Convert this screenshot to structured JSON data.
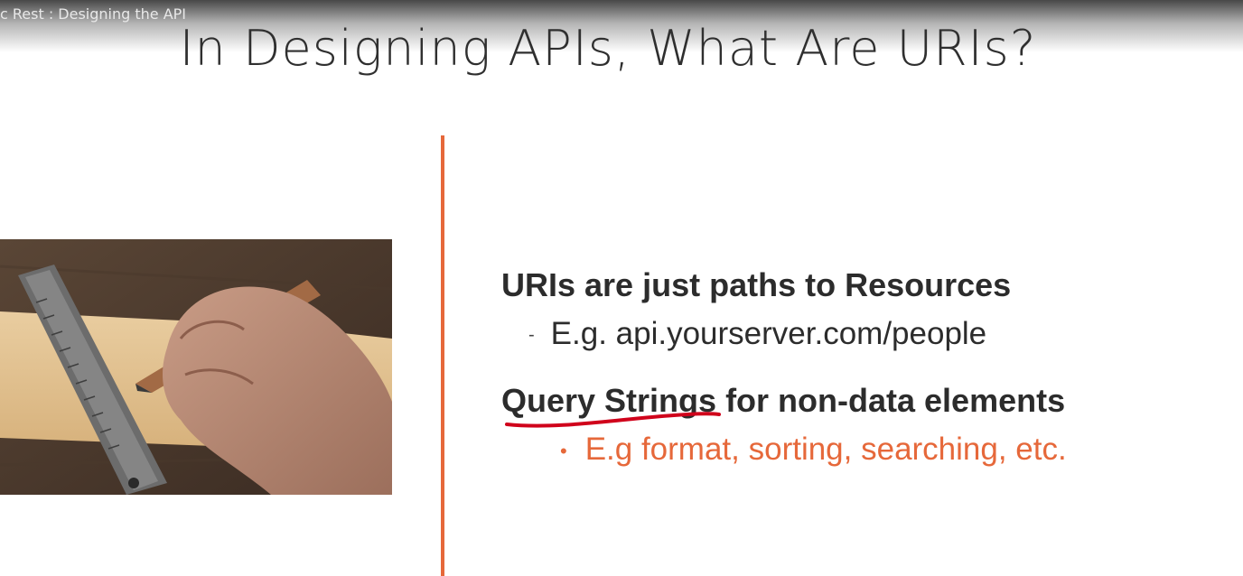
{
  "video": {
    "title": "c Rest : Designing the API"
  },
  "slide": {
    "title": "In Designing APIs, What Are URIs?",
    "accent_color": "#e6683a",
    "point1": "URIs are just paths to Resources",
    "point1_dash": "-",
    "point1_sub": "E.g. api.yourserver.com/people",
    "point2": "Query Strings for non-data elements",
    "point2_bullet": "•",
    "point2_sub": "E.g  format, sorting, searching, etc."
  },
  "annotation": {
    "color": "#d0021b"
  }
}
